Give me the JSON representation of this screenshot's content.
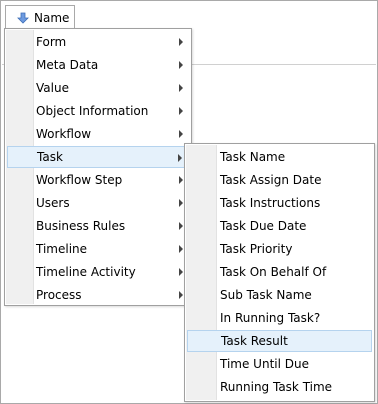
{
  "header": {
    "button_label": "Name",
    "button_icon": "sort-down-arrow-icon",
    "icon_color": "#4a7ecb"
  },
  "menu": {
    "items": [
      {
        "label": "Form",
        "has_submenu": true
      },
      {
        "label": "Meta Data",
        "has_submenu": true
      },
      {
        "label": "Value",
        "has_submenu": true
      },
      {
        "label": "Object Information",
        "has_submenu": true
      },
      {
        "label": "Workflow",
        "has_submenu": true
      },
      {
        "label": "Task",
        "has_submenu": true,
        "highlighted": true
      },
      {
        "label": "Workflow Step",
        "has_submenu": true
      },
      {
        "label": "Users",
        "has_submenu": true
      },
      {
        "label": "Business Rules",
        "has_submenu": true
      },
      {
        "label": "Timeline",
        "has_submenu": true
      },
      {
        "label": "Timeline Activity",
        "has_submenu": true
      },
      {
        "label": "Process",
        "has_submenu": true
      }
    ]
  },
  "submenu": {
    "items": [
      {
        "label": "Task Name"
      },
      {
        "label": "Task Assign Date"
      },
      {
        "label": "Task Instructions"
      },
      {
        "label": "Task Due Date"
      },
      {
        "label": "Task Priority"
      },
      {
        "label": "Task On Behalf Of"
      },
      {
        "label": "Sub Task Name"
      },
      {
        "label": "In Running Task?"
      },
      {
        "label": "Task Result",
        "highlighted": true
      },
      {
        "label": "Time Until Due"
      },
      {
        "label": "Running Task Time"
      }
    ]
  },
  "colors": {
    "highlight_bg": "#e5f1fb",
    "highlight_border": "#b5d3ee",
    "gutter": "#f0f0f0"
  }
}
